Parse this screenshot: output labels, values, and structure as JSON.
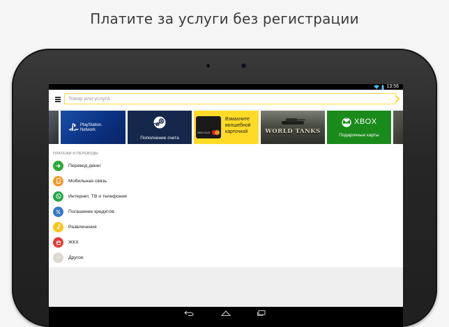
{
  "headline": "Платите за услуги без регистрации",
  "status": {
    "time": "13:56"
  },
  "search": {
    "placeholder": "Товар или услуга"
  },
  "banners": {
    "playstation": {
      "line1": "PlayStation.",
      "line2": "Network"
    },
    "steam": {
      "label": "Пополнение счета"
    },
    "card": {
      "number": "0000 0123",
      "text_lines": [
        "Взмахните",
        "волшебной",
        "карточкой"
      ]
    },
    "wot": {
      "title": "WORLD TANKS"
    },
    "xbox": {
      "word": "XBOX",
      "label": "Подарочные карты"
    }
  },
  "section": {
    "title": "ПЛАТЕЖИ И ПЕРЕВОДЫ",
    "items": [
      {
        "label": "Перевод денег",
        "icon": "arrow-right-icon",
        "color": "#2eaa3a"
      },
      {
        "label": "Мобильная связь",
        "icon": "phone-icon",
        "color": "#f39a2a"
      },
      {
        "label": "Интернет, ТВ и телефония",
        "icon": "globe-phone-icon",
        "color": "#27a84a"
      },
      {
        "label": "Погашение кредитов",
        "icon": "percent-icon",
        "color": "#3b78c4"
      },
      {
        "label": "Развлечения",
        "icon": "music-note-icon",
        "color": "#f6c81b"
      },
      {
        "label": "ЖКХ",
        "icon": "house-icon",
        "color": "#e23b34"
      },
      {
        "label": "Другое",
        "icon": "dots-icon",
        "color": "#dcd8cf"
      }
    ]
  },
  "colors": {
    "accent": "#ffd633",
    "brand_xbox": "#1a8a1a",
    "steam": "#15284c"
  }
}
